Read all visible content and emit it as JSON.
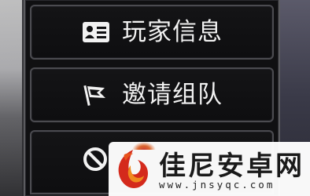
{
  "menu": {
    "items": [
      {
        "label": "玩家信息",
        "icon": "id-card-icon"
      },
      {
        "label": "邀请组队",
        "icon": "flag-icon"
      },
      {
        "label": "",
        "icon": "prohibited-icon"
      }
    ]
  },
  "watermark": {
    "title": "佳尼安卓网",
    "url": "www.jnsyqc.com"
  },
  "colors": {
    "menu_bg": "#101012",
    "item_border": "#4b4b50",
    "text": "#f2f2f2",
    "logo_red": "#d42a1c",
    "logo_orange": "#f08a1e"
  }
}
